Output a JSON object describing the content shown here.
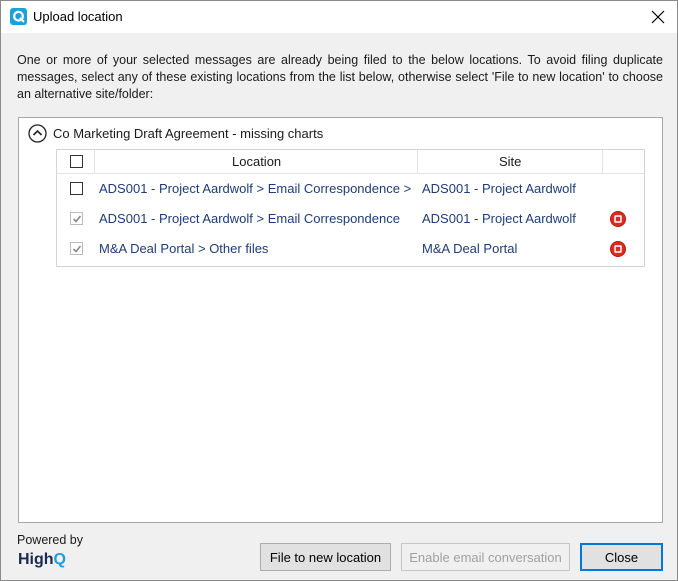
{
  "window": {
    "title": "Upload location",
    "close_glyph": "✕",
    "app_icon": "highq-app-icon"
  },
  "intro_text": "One or more of your selected messages are already being filed to the below locations. To avoid filing duplicate messages, select any of these existing locations from the list below, otherwise select 'File to new location' to choose an alternative site/folder:",
  "group": {
    "title": "Co Marketing Draft Agreement - missing charts",
    "expanded": true
  },
  "table": {
    "columns": [
      "Location",
      "Site"
    ],
    "rows": [
      {
        "location": "ADS001 - Project Aardwolf > Email Correspondence > ",
        "site": "ADS001 - Project Aardwolf",
        "checked": false,
        "enabled": true,
        "removable": false
      },
      {
        "location": "ADS001 - Project Aardwolf > Email Correspondence",
        "site": "ADS001 - Project Aardwolf",
        "checked": true,
        "enabled": false,
        "removable": true
      },
      {
        "location": "M&A Deal Portal > Other files",
        "site": "M&A Deal Portal",
        "checked": true,
        "enabled": false,
        "removable": true
      }
    ]
  },
  "footer": {
    "powered_by": "Powered by",
    "logo_high": "High",
    "logo_q": "Q",
    "buttons": {
      "file_new": "File to new location",
      "enable_email": "Enable email conversation",
      "close": "Close"
    }
  },
  "colors": {
    "link_text": "#1f3c78",
    "remove_red": "#e02a1d",
    "accent": "#0078d7",
    "logo_cyan": "#1ba0d8"
  }
}
